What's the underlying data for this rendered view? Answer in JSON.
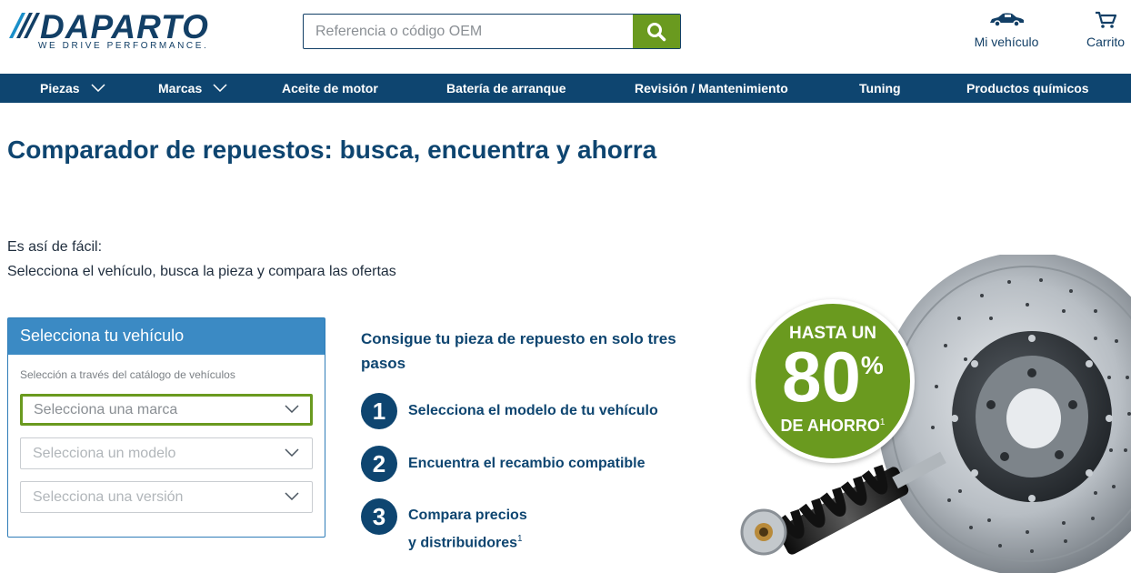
{
  "brand": {
    "name": "DAPARTO",
    "tagline": "WE DRIVE PERFORMANCE."
  },
  "search": {
    "placeholder": "Referencia o código OEM"
  },
  "header_links": {
    "vehicle": "Mi vehículo",
    "cart": "Carrito"
  },
  "nav": [
    {
      "label": "Piezas",
      "dropdown": true
    },
    {
      "label": "Marcas",
      "dropdown": true
    },
    {
      "label": "Aceite de motor",
      "dropdown": false
    },
    {
      "label": "Batería de arranque",
      "dropdown": false
    },
    {
      "label": "Revisión / Mantenimiento",
      "dropdown": false
    },
    {
      "label": "Tuning",
      "dropdown": false
    },
    {
      "label": "Productos químicos",
      "dropdown": false
    }
  ],
  "page": {
    "title": "Comparador de repuestos: busca, encuentra y ahorra",
    "intro_line1": "Es así de fácil:",
    "intro_line2": "Selecciona el vehículo, busca la pieza y compara las ofertas"
  },
  "vehicle_selector": {
    "title": "Selecciona tu vehículo",
    "subtitle": "Selección a través del catálogo de vehículos",
    "brand_placeholder": "Selecciona una marca",
    "model_placeholder": "Selecciona un modelo",
    "version_placeholder": "Selecciona una versión"
  },
  "steps": {
    "title": "Consigue tu pieza de repuesto en solo tres pasos",
    "items": [
      {
        "number": "1",
        "text": "Selecciona el modelo de tu vehículo"
      },
      {
        "number": "2",
        "text": "Encuentra el recambio compatible"
      },
      {
        "number": "3",
        "text_line1": "Compara precios",
        "text_line2": "y distribuidores",
        "footnote": "1"
      }
    ]
  },
  "promo": {
    "line1": "HASTA UN",
    "value": "80",
    "unit": "%",
    "line2": "DE AHORRO",
    "footnote": "1"
  },
  "colors": {
    "navy": "#0e4570",
    "accent_green": "#6a9a1f",
    "panel_blue": "#3b8ac4"
  }
}
